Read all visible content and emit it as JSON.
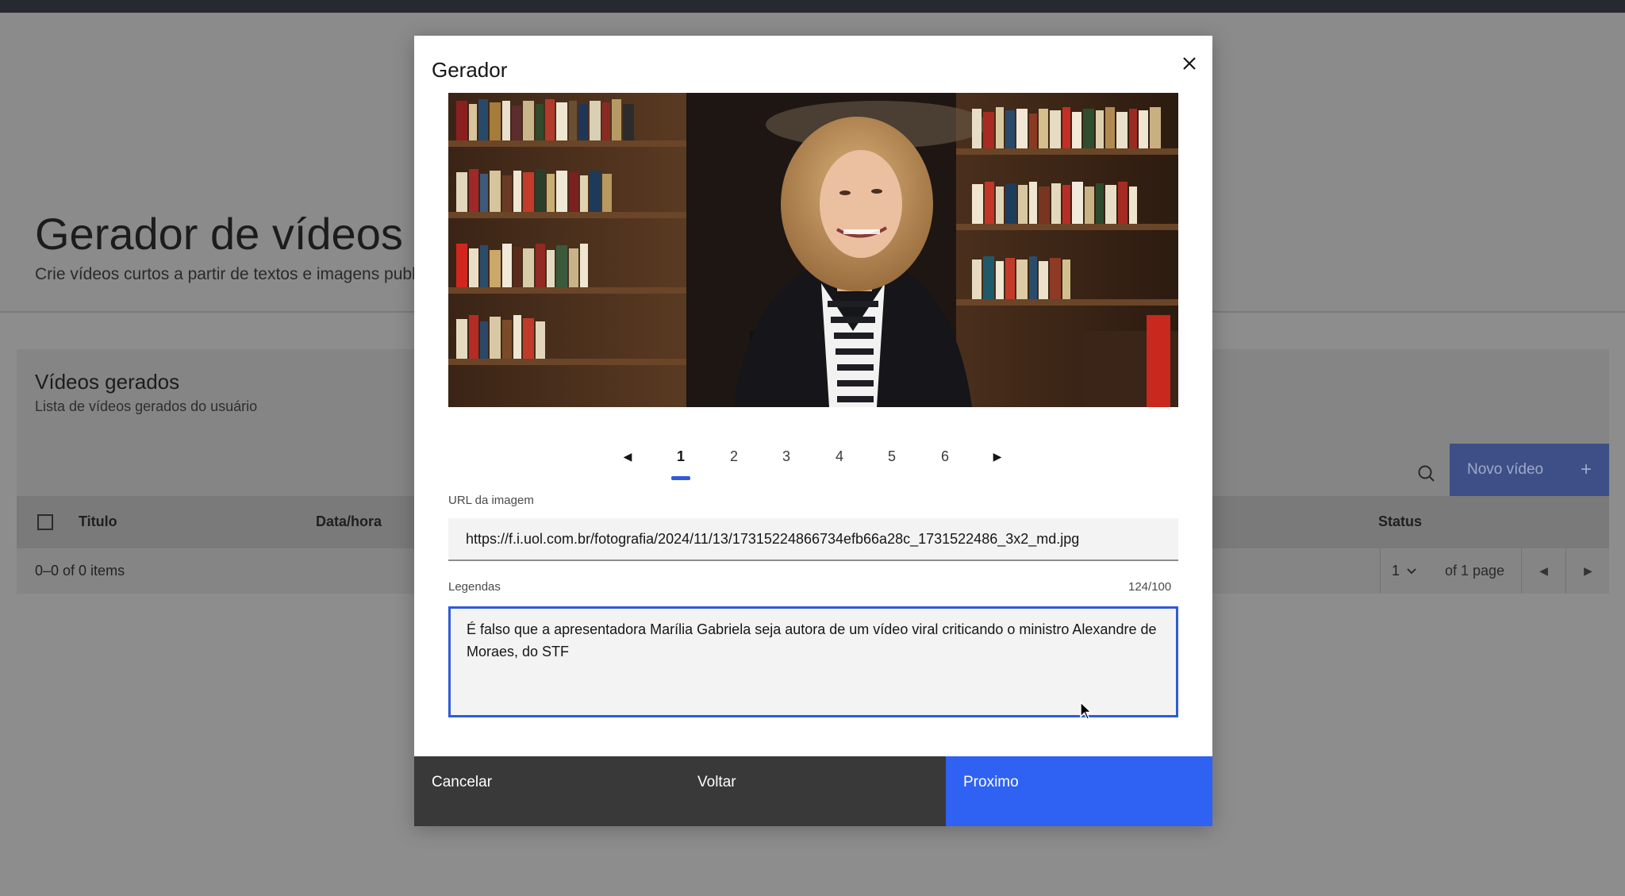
{
  "page": {
    "title": "Gerador de vídeos",
    "subtitle": "Crie vídeos curtos a partir de textos e imagens public"
  },
  "videos_card": {
    "title": "Vídeos gerados",
    "subtitle": "Lista de vídeos gerados do usuário",
    "new_button_label": "Novo vídeo",
    "new_button_icon": "+",
    "columns": {
      "title": "Titulo",
      "datetime": "Data/hora",
      "status": "Status"
    },
    "items_count": "0–0 of 0 items",
    "pager": {
      "page": "1",
      "of_pages": "of 1 page"
    }
  },
  "modal": {
    "title": "Gerador",
    "close_icon": "×",
    "slides": [
      "1",
      "2",
      "3",
      "4",
      "5",
      "6"
    ],
    "active_slide": "1",
    "url_label": "URL da imagem",
    "url_value": "https://f.i.uol.com.br/fotografia/2024/11/13/17315224866734efb66a28c_1731522486_3x2_md.jpg",
    "caption_label": "Legendas",
    "caption_counter": "124/100",
    "caption_value": "É falso que a apresentadora Marília Gabriela seja autora de um vídeo viral criticando o ministro Alexandre de Moraes, do STF",
    "buttons": {
      "cancel": "Cancelar",
      "back": "Voltar",
      "next": "Proximo"
    }
  },
  "colors": {
    "accent": "#2f62f2",
    "active_indicator": "#2f5bd8",
    "footer_dark": "#393939",
    "overlay": "#8d8d8d"
  }
}
